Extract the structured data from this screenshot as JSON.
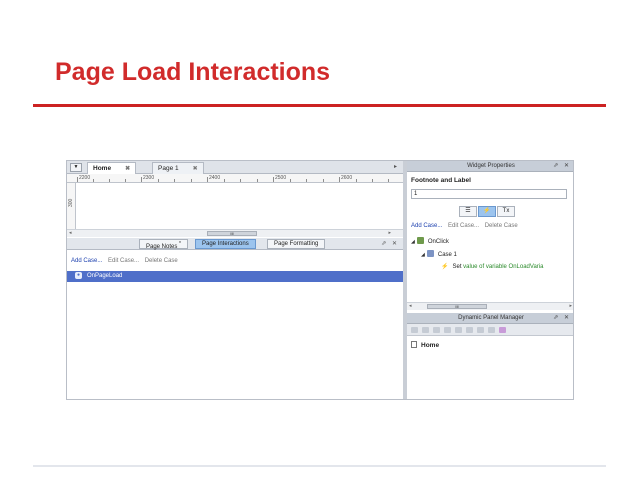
{
  "slide": {
    "title": "Page Load Interactions"
  },
  "designer": {
    "tabs": [
      {
        "label": "Home",
        "close": "✖"
      },
      {
        "label": "Page 1",
        "close": "✖"
      }
    ],
    "ruler": {
      "marks": [
        "2200",
        "2300",
        "2400",
        "2500",
        "2600"
      ],
      "vertical": "300"
    },
    "scroll_thumb": "III",
    "lower_tabs": [
      "Page Notes",
      "Page Interactions",
      "Page Formatting"
    ],
    "page_notes_marker": "*",
    "actions": {
      "add": "Add Case...",
      "edit": "Edit Case...",
      "delete": "Delete Case"
    },
    "event": "OnPageLoad",
    "pin_close": "⇗ ✕"
  },
  "widget_properties": {
    "header": "Widget Properties",
    "footnote_label": "Footnote and Label",
    "footnote_value": "1",
    "icons": [
      "☰",
      "⚡",
      "Tx"
    ],
    "actions": {
      "add": "Add Case...",
      "edit": "Edit Case...",
      "delete": "Delete Case"
    },
    "tree": {
      "event": "OnClick",
      "case": "Case 1",
      "action_prefix": "Set",
      "action_rest": "value of variable OnLoadVaria"
    },
    "scroll_thumb": "III"
  },
  "dynamic_panel_manager": {
    "header": "Dynamic Panel Manager",
    "home": "Home"
  },
  "colors": {
    "title_red": "#d12b2b",
    "selection_blue": "#4f6fc9",
    "tab_active": "#9cc4ee"
  }
}
